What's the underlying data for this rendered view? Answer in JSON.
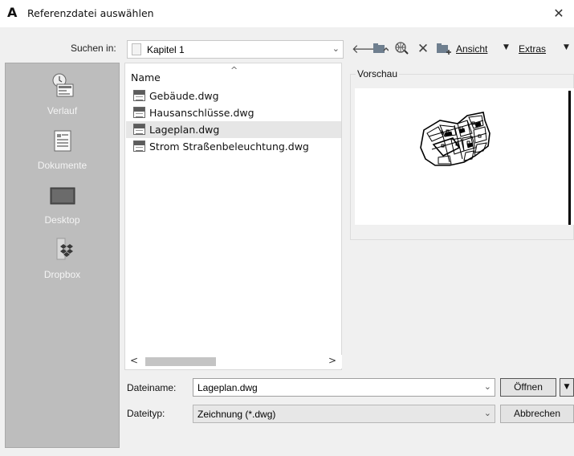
{
  "window": {
    "title": "Referenzdatei auswählen",
    "close_glyph": "✕",
    "app_icon": "autocad-a-icon"
  },
  "lookin": {
    "label": "Suchen in:",
    "value": "Kapitel 1"
  },
  "toolbar": {
    "icons": [
      "back-arrow-icon",
      "up-folder-icon",
      "search-web-icon",
      "delete-icon",
      "new-folder-icon"
    ],
    "view_label": "Ansicht",
    "tools_label": "Extras"
  },
  "places": [
    {
      "label": "Verlauf",
      "icon": "history-icon"
    },
    {
      "label": "Dokumente",
      "icon": "documents-icon"
    },
    {
      "label": "Desktop",
      "icon": "desktop-icon"
    },
    {
      "label": "Dropbox",
      "icon": "dropbox-icon"
    }
  ],
  "filelist": {
    "column_name": "Name",
    "files": [
      {
        "name": "Gebäude.dwg",
        "selected": false
      },
      {
        "name": "Hausanschlüsse.dwg",
        "selected": false
      },
      {
        "name": "Lageplan.dwg",
        "selected": true
      },
      {
        "name": "Strom Straßenbeleuchtung.dwg",
        "selected": false
      }
    ]
  },
  "preview": {
    "label": "Vorschau"
  },
  "filename": {
    "label": "Dateiname:",
    "value": "Lageplan.dwg"
  },
  "filetype": {
    "label": "Dateityp:",
    "value": "Zeichnung (*.dwg)"
  },
  "buttons": {
    "open": "Öffnen",
    "cancel": "Abbrechen"
  },
  "colors": {
    "places_bg": "#bdbdbd",
    "selection": "#e6e6e6",
    "dialog_bg": "#f0f0f0"
  }
}
